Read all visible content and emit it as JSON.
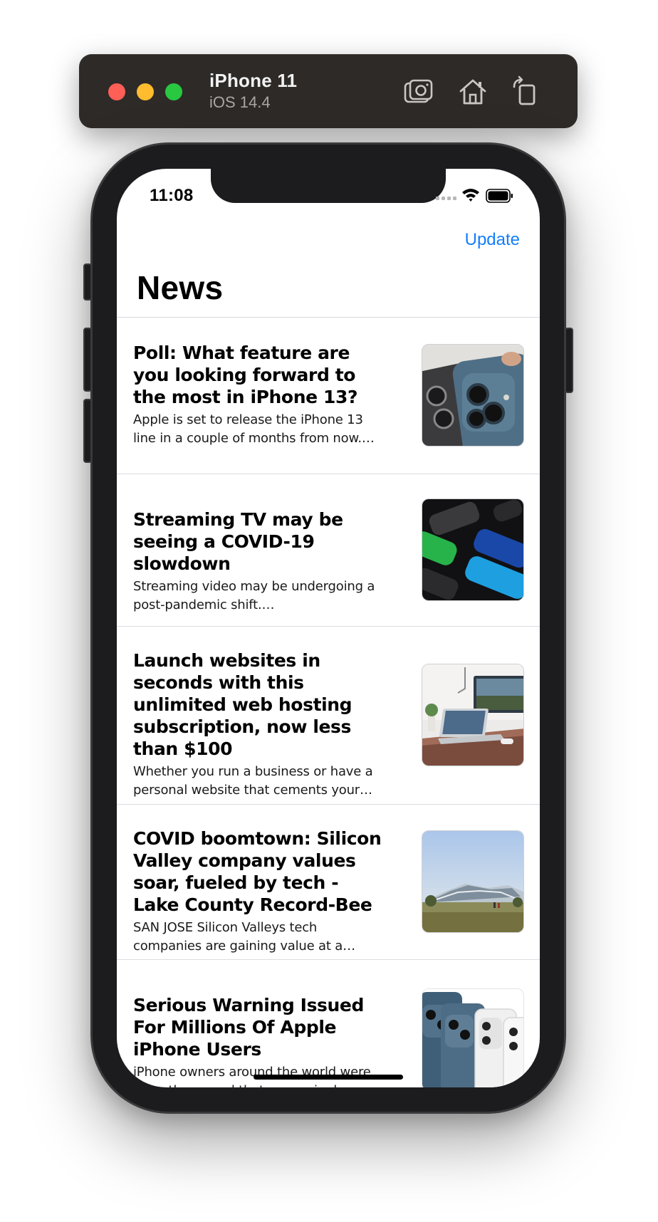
{
  "simulator": {
    "device_name": "iPhone 11",
    "os_version": "iOS 14.4",
    "buttons": [
      "screenshot",
      "home",
      "rotate"
    ]
  },
  "status_bar": {
    "time": "11:08"
  },
  "nav": {
    "right_button": "Update",
    "title": "News",
    "accent_color": "#147efb"
  },
  "articles": [
    {
      "title": "Poll: What feature are you looking forward to the most in iPhone 13?",
      "description": "Apple is set to release the iPhone 13 line in a couple of months from now. With this upda…",
      "thumbnail": "iphone-cameras-photo"
    },
    {
      "title": "Streaming TV may be seeing a COVID-19 slowdown",
      "description": "Streaming video may be undergoing a post-pandemic shift.…",
      "thumbnail": "remote-control-buttons-photo"
    },
    {
      "title": "Launch websites in seconds with this unlimited web hosting subscription, now less than $100",
      "description": "Whether you run a business or have a personal website that cements your profes…",
      "thumbnail": "laptop-desk-photo"
    },
    {
      "title": "COVID boomtown: Silicon Valley company values soar, fueled by tech - Lake County Record-Bee",
      "description": "SAN JOSE Silicon Valleys tech companies are gaining value at a dramatic pace, a sign…",
      "thumbnail": "campus-building-photo"
    },
    {
      "title": "Serious Warning Issued For Millions Of Apple iPhone Users",
      "description": "iPhone owners around the world were recently warned that a seemingly harmless…",
      "thumbnail": "iphones-lineup-photo"
    }
  ]
}
